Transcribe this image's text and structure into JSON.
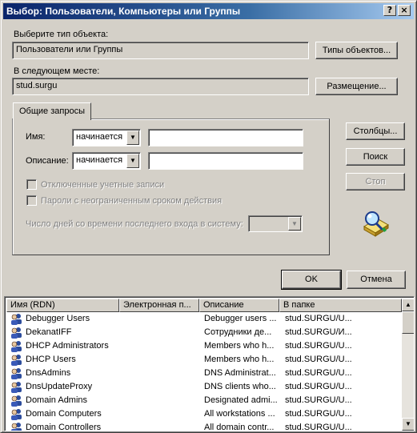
{
  "window": {
    "title": "Выбор: Пользователи, Компьютеры или Группы",
    "help_glyph": "?",
    "close_glyph": "×"
  },
  "object_type": {
    "label": "Выберите тип объекта:",
    "value": "Пользователи или Группы",
    "button": "Типы объектов..."
  },
  "location": {
    "label": "В следующем месте:",
    "value": "stud.surgu",
    "button": "Размещение..."
  },
  "tab": {
    "label": "Общие запросы"
  },
  "query": {
    "name_label": "Имя:",
    "name_mode": "начинается",
    "name_value": "",
    "desc_label": "Описание:",
    "desc_mode": "начинается",
    "desc_value": "",
    "disabled_accounts": "Отключенные учетные записи",
    "non_expiring_pw": "Пароли с неограниченным сроком действия",
    "days_since_logon": "Число дней со времени последнего входа в систему:",
    "days_value": ""
  },
  "side_buttons": {
    "columns": "Столбцы...",
    "search": "Поиск",
    "stop": "Стоп"
  },
  "dialog_buttons": {
    "ok": "OK",
    "cancel": "Отмена"
  },
  "results": {
    "columns": [
      "Имя (RDN)",
      "Электронная п...",
      "Описание",
      "В папке"
    ],
    "rows": [
      {
        "name": "Debugger Users",
        "email": "",
        "desc": "Debugger users ...",
        "folder": "stud.SURGU/U..."
      },
      {
        "name": "DekanatIFF",
        "email": "",
        "desc": "Сотрудники де...",
        "folder": "stud.SURGU/И..."
      },
      {
        "name": "DHCP Administrators",
        "email": "",
        "desc": "Members who h...",
        "folder": "stud.SURGU/U..."
      },
      {
        "name": "DHCP Users",
        "email": "",
        "desc": "Members who h...",
        "folder": "stud.SURGU/U..."
      },
      {
        "name": "DnsAdmins",
        "email": "",
        "desc": "DNS Administrat...",
        "folder": "stud.SURGU/U..."
      },
      {
        "name": "DnsUpdateProxy",
        "email": "",
        "desc": "DNS clients who...",
        "folder": "stud.SURGU/U..."
      },
      {
        "name": "Domain Admins",
        "email": "",
        "desc": "Designated admi...",
        "folder": "stud.SURGU/U..."
      },
      {
        "name": "Domain Computers",
        "email": "",
        "desc": "All workstations ...",
        "folder": "stud.SURGU/U..."
      },
      {
        "name": "Domain Controllers",
        "email": "",
        "desc": "All domain contr...",
        "folder": "stud.SURGU/U..."
      }
    ]
  },
  "icons": {
    "row_icon": "user-group-icon",
    "search_graphic": "magnifier-search-icon"
  },
  "colors": {
    "face": "#d4d0c8",
    "title_start": "#0a246a",
    "title_end": "#a6caf0",
    "disabled_text": "#808080"
  }
}
